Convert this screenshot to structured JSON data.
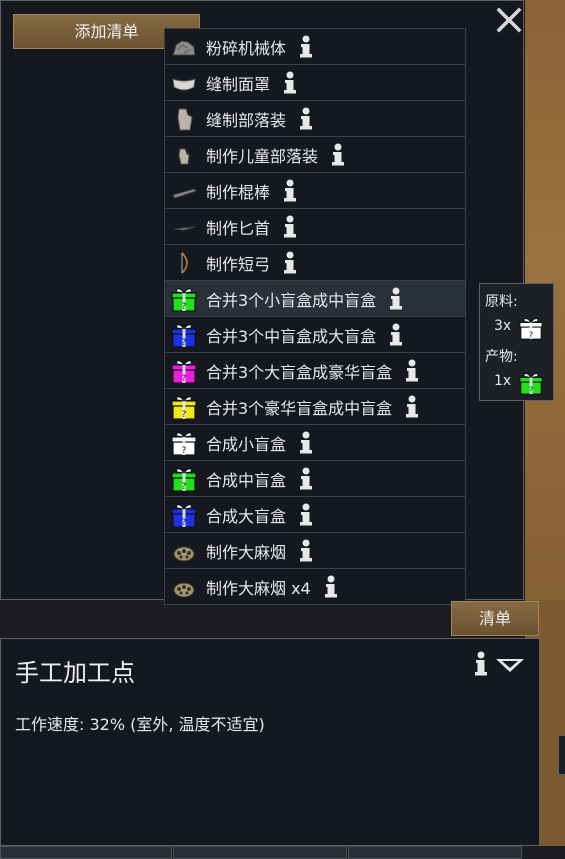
{
  "bill_panel": {
    "add_bill_label": "添加清单",
    "close_icon": "close-icon"
  },
  "menu": {
    "items": [
      {
        "label": "粉碎机械体",
        "icon": "rubble-icon"
      },
      {
        "label": "缝制面罩",
        "icon": "mask-icon"
      },
      {
        "label": "缝制部落装",
        "icon": "tribalwear-icon"
      },
      {
        "label": "制作儿童部落装",
        "icon": "child-tribalwear-icon"
      },
      {
        "label": "制作棍棒",
        "icon": "club-icon"
      },
      {
        "label": "制作匕首",
        "icon": "knife-icon"
      },
      {
        "label": "制作短弓",
        "icon": "shortbow-icon"
      },
      {
        "label": "合并3个小盲盒成中盲盒",
        "icon": "gift-box-green-icon"
      },
      {
        "label": "合并3个中盲盒成大盲盒",
        "icon": "gift-box-blue-icon"
      },
      {
        "label": "合并3个大盲盒成豪华盲盒",
        "icon": "gift-box-magenta-icon"
      },
      {
        "label": "合并3个豪华盲盒成中盲盒",
        "icon": "gift-box-yellow-icon"
      },
      {
        "label": "合成小盲盒",
        "icon": "gift-box-white-icon"
      },
      {
        "label": "合成中盲盒",
        "icon": "gift-box-green-icon"
      },
      {
        "label": "合成大盲盒",
        "icon": "gift-box-blue-icon"
      },
      {
        "label": "制作大麻烟",
        "icon": "joint-icon"
      },
      {
        "label": "制作大麻烟 x4",
        "icon": "joint-icon"
      }
    ],
    "hovered_index": 7
  },
  "tooltip": {
    "ingredients_label": "原料:",
    "ingredients_count": "3x",
    "products_label": "产物:",
    "products_count": "1x"
  },
  "list_button_label": "清单",
  "workbench": {
    "title": "手工加工点",
    "speed_text": "工作速度: 32% (室外, 温度不适宜)"
  },
  "colors": {
    "gift_white": "#ffffff",
    "gift_green": "#22e01a",
    "gift_blue": "#1c30e8",
    "gift_magenta": "#f01ce0",
    "gift_yellow": "#f0e81a",
    "button_bg": "#7a5f3b"
  }
}
